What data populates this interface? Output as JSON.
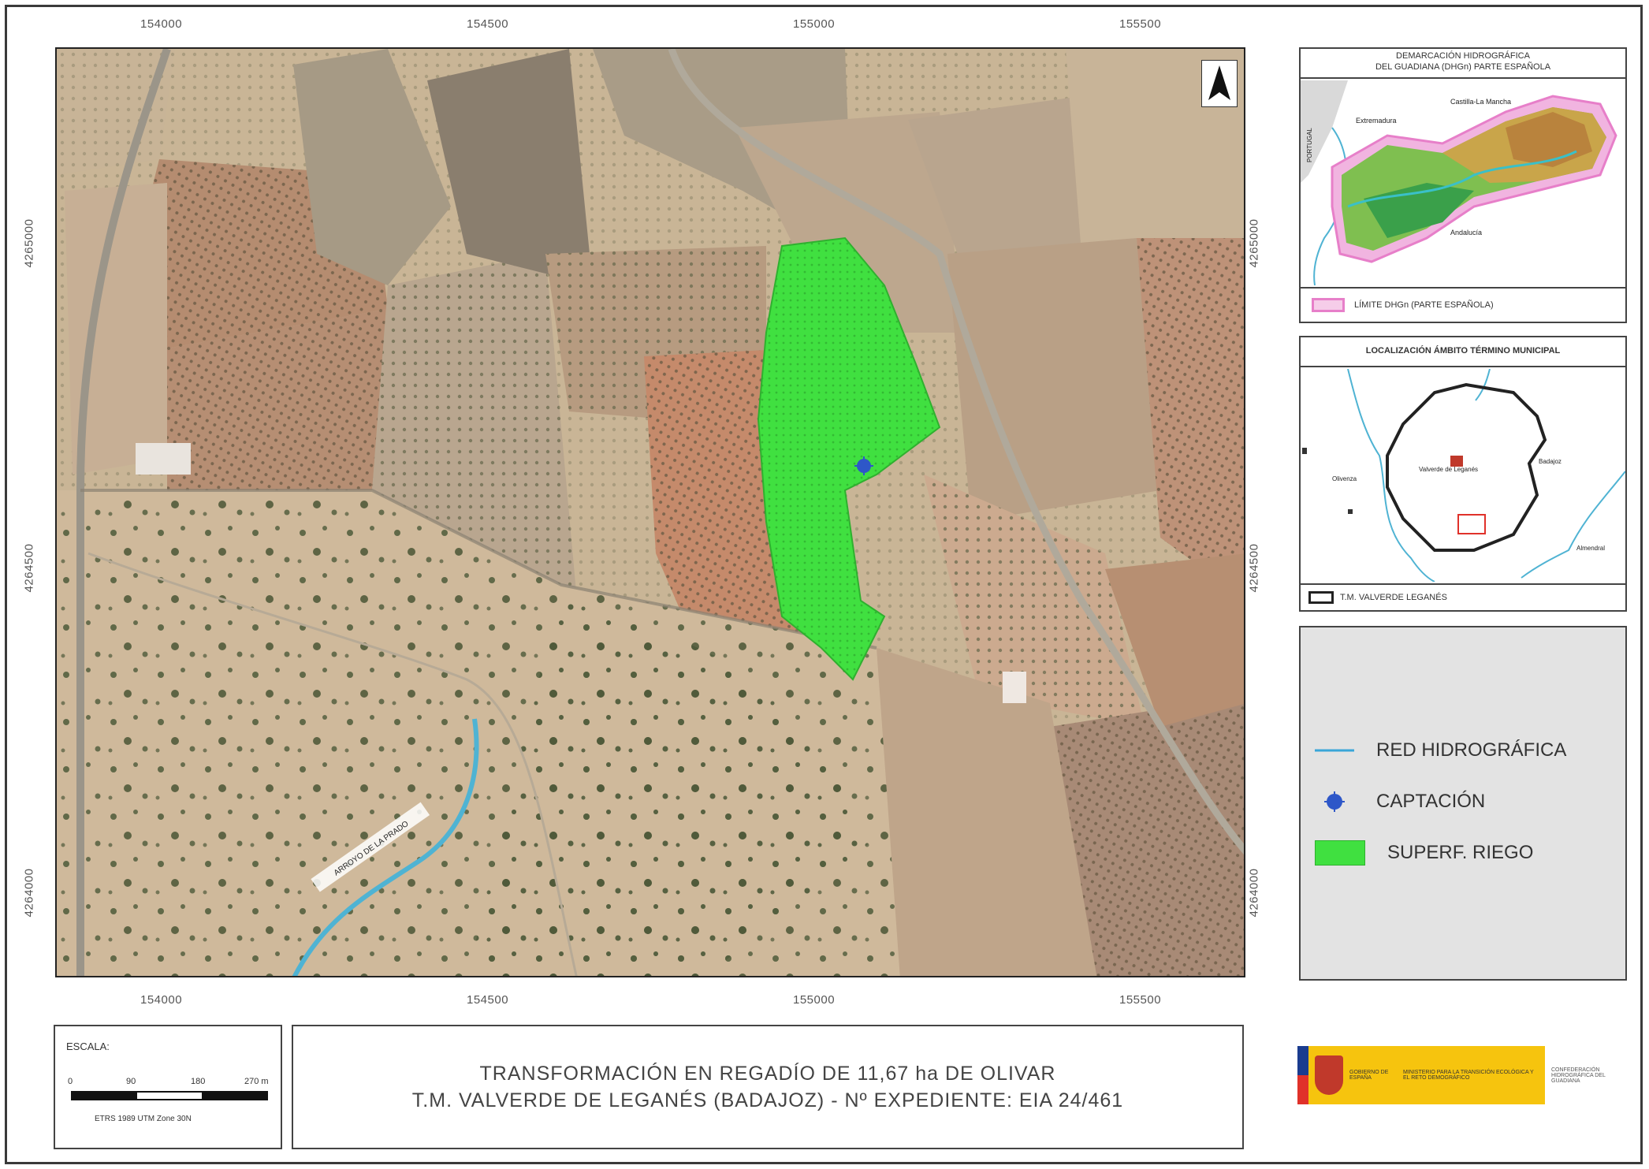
{
  "coords": {
    "top": [
      "154000",
      "154500",
      "155000",
      "155500"
    ],
    "bottom": [
      "154000",
      "154500",
      "155000",
      "155500"
    ],
    "left": [
      "4265000",
      "4264500",
      "4264000"
    ],
    "right": [
      "4265000",
      "4264500",
      "4264000"
    ]
  },
  "map_labels": {
    "stream": "ARROYO DE LA PRADO"
  },
  "inset_basin": {
    "title_line1": "DEMARCACIÓN HIDROGRÁFICA",
    "title_line2": "DEL GUADIANA (DHGn) PARTE ESPAÑOLA",
    "regions": [
      "Extremadura",
      "Castilla-La Mancha",
      "Andalucía"
    ],
    "portugal": "PORTUGAL",
    "legend": "LÍMITE DHGn (PARTE ESPAÑOLA)"
  },
  "inset_municipal": {
    "title": "LOCALIZACIÓN ÁMBITO TÉRMINO MUNICIPAL",
    "towns": [
      "Valverde de Leganés",
      "Olivenza",
      "Badajoz",
      "Almendral"
    ],
    "legend": "T.M. VALVERDE LEGANÉS"
  },
  "legend": {
    "items": [
      {
        "label": "RED HIDROGRÁFICA",
        "color": "#3aa6d8"
      },
      {
        "label": "CAPTACIÓN",
        "color": "#2e57c8"
      },
      {
        "label": "SUPERF. RIEGO",
        "color": "#40e040"
      }
    ]
  },
  "scale": {
    "title": "ESCALA:",
    "ticks": [
      "0",
      "90",
      "180",
      "270 m"
    ],
    "crs": "ETRS 1989 UTM Zone 30N"
  },
  "title": {
    "line1": "TRANSFORMACIÓN EN REGADÍO DE 11,67 ha DE OLIVAR",
    "line2": "T.M. VALVERDE DE LEGANÉS (BADAJOZ)  -  Nº EXPEDIENTE: EIA 24/461"
  },
  "logo": {
    "gobierno": "GOBIERNO DE ESPAÑA",
    "ministerio": "MINISTERIO PARA LA TRANSICIÓN ECOLÓGICA Y EL RETO DEMOGRÁFICO",
    "confederacion": "CONFEDERACIÓN HIDROGRÁFICA DEL GUADIANA"
  }
}
